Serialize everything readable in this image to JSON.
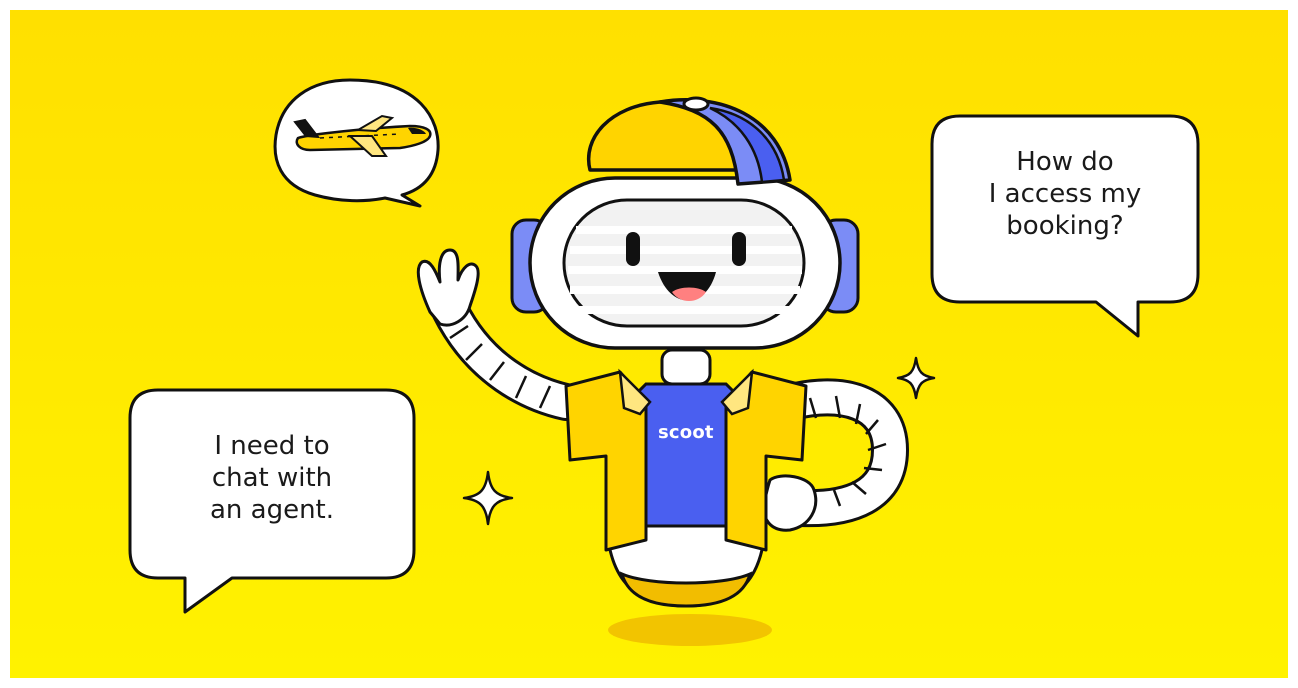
{
  "bubbles": {
    "right": "How do\nI access my\nbooking?",
    "left": "I need to\nchat with\nan agent."
  },
  "mascot": {
    "shirt_logo": "scoot"
  },
  "colors": {
    "background_top": "#ffe000",
    "background_bottom": "#fff200",
    "brand_yellow": "#ffd400",
    "brand_blue": "#4a5ff0",
    "outline": "#111111"
  },
  "icons": [
    "airplane-icon",
    "sparkle-icon",
    "sparkle-icon"
  ]
}
